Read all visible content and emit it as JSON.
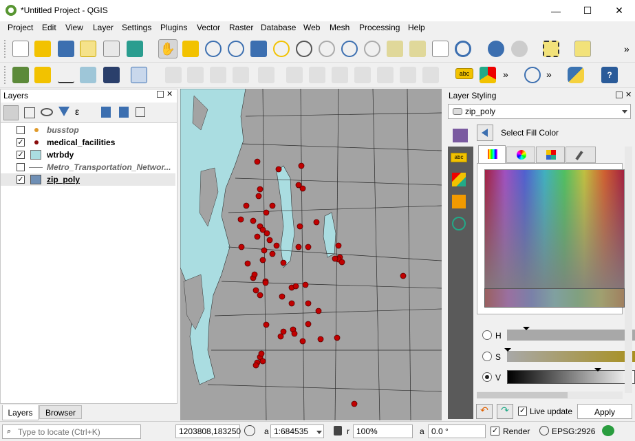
{
  "app": {
    "title": "*Untitled Project - QGIS"
  },
  "window_controls": {
    "minimize": "—",
    "maximize": "☐",
    "close": "✕"
  },
  "menu": [
    "Project",
    "Edit",
    "View",
    "Layer",
    "Settings",
    "Plugins",
    "Vector",
    "Raster",
    "Database",
    "Web",
    "Mesh",
    "Processing",
    "Help"
  ],
  "layers_panel": {
    "title": "Layers",
    "items": [
      {
        "name": "busstop",
        "checked": false,
        "style": "italic"
      },
      {
        "name": "medical_facilities",
        "checked": true,
        "style": "bold"
      },
      {
        "name": "wtrbdy",
        "checked": true,
        "style": "bold"
      },
      {
        "name": "Metro_Transportation_Networ...",
        "checked": false,
        "style": "italic"
      },
      {
        "name": "zip_poly",
        "checked": true,
        "style": "bold-underline"
      }
    ],
    "check_mark": "✓",
    "tabs": [
      "Layers",
      "Browser"
    ]
  },
  "styling_panel": {
    "title": "Layer Styling",
    "layer_select": "zip_poly",
    "section_title": "Select Fill Color",
    "hsv_labels": [
      "H",
      "S",
      "V"
    ],
    "live_update_label": "Live update",
    "apply_label": "Apply",
    "abc_label": "abc"
  },
  "statusbar": {
    "locate_placeholder": "Type to locate (Ctrl+K)",
    "coordinate": "1203808,183250",
    "scale_label": "a",
    "scale": "1:684535",
    "magnifier_label": "r",
    "magnifier": "100%",
    "rotation_label": "a",
    "rotation": "0.0 °",
    "render_label": "Render",
    "crs": "EPSG:2926"
  },
  "colors": {
    "water": "#aadde1",
    "land": "#a3a3a3",
    "points": "#c00000",
    "wtrbdy_swatch": "#aadde1",
    "zip_swatch": "#6f8fb5"
  }
}
